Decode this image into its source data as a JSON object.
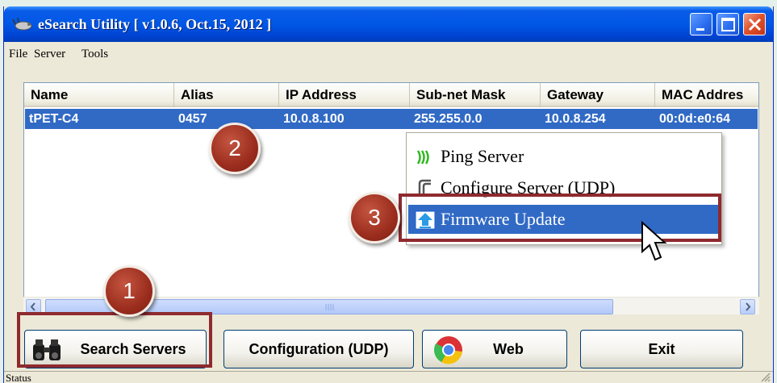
{
  "window": {
    "title": "eSearch Utility [ v1.0.6, Oct.15, 2012 ]",
    "controls": [
      "minimize",
      "maximize",
      "close"
    ]
  },
  "menu": [
    "File",
    "Server",
    "Tools"
  ],
  "table": {
    "columns": [
      "Name",
      "Alias",
      "IP Address",
      "Sub-net Mask",
      "Gateway",
      "MAC Addres"
    ],
    "rows": [
      [
        "tPET-C4",
        "0457",
        "10.0.8.100",
        "255.255.0.0",
        "10.0.8.254",
        "00:0d:e0:64"
      ]
    ],
    "selected_row": 0
  },
  "context_menu": {
    "items": [
      {
        "label": "Ping Server",
        "icon": "ping-wave-icon"
      },
      {
        "label": "Configure Server (UDP)",
        "icon": "configure-icon"
      },
      {
        "label": "Firmware Update",
        "icon": "upload-arrow-icon",
        "selected": true
      }
    ]
  },
  "buttons": {
    "search": "Search Servers",
    "configuration": "Configuration (UDP)",
    "web": "Web",
    "exit": "Exit"
  },
  "status": "Status",
  "annotations": {
    "step1": "1",
    "step2": "2",
    "step3": "3",
    "highlight_color": "#8e2a2e"
  },
  "colors": {
    "titlebar": "#0058e6",
    "selection": "#316ac5",
    "window_bg": "#ece9d8"
  }
}
